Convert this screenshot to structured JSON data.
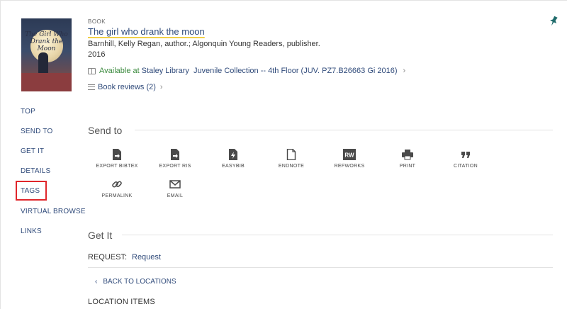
{
  "record": {
    "type": "BOOK",
    "title": "The girl who drank the moon",
    "author": "Barnhill, Kelly Regan, author.; Algonquin Young Readers, publisher.",
    "year": "2016",
    "availability": {
      "status": "Available at",
      "library": "Staley Library",
      "collection": "Juvenile Collection -- 4th Floor (JUV. PZ7.B26663 Gi 2016)"
    },
    "reviews": "Book reviews (2)",
    "cover_title": "The Girl Who Drank the Moon"
  },
  "nav": {
    "items": [
      "TOP",
      "SEND TO",
      "GET IT",
      "DETAILS",
      "TAGS",
      "VIRTUAL BROWSE",
      "LINKS"
    ]
  },
  "send_to": {
    "title": "Send to",
    "actions": [
      {
        "label": "EXPORT BIBTEX",
        "icon": "file-export-icon"
      },
      {
        "label": "EXPORT RIS",
        "icon": "file-export-icon"
      },
      {
        "label": "EASYBIB",
        "icon": "easybib-icon"
      },
      {
        "label": "ENDNOTE",
        "icon": "document-icon"
      },
      {
        "label": "REFWORKS",
        "icon": "refworks-icon",
        "icon_text": "RW"
      },
      {
        "label": "PRINT",
        "icon": "printer-icon"
      },
      {
        "label": "CITATION",
        "icon": "quote-icon"
      },
      {
        "label": "PERMALINK",
        "icon": "link-icon"
      },
      {
        "label": "EMAIL",
        "icon": "envelope-icon"
      }
    ]
  },
  "get_it": {
    "title": "Get It",
    "request_label": "REQUEST:",
    "request_link": "Request",
    "back_label": "BACK TO LOCATIONS",
    "location_items": "LOCATION ITEMS"
  },
  "colors": {
    "link": "#2f4a7a",
    "available": "#3b8a3e",
    "highlight": "#e0262b",
    "title_underline": "#f2d048"
  }
}
